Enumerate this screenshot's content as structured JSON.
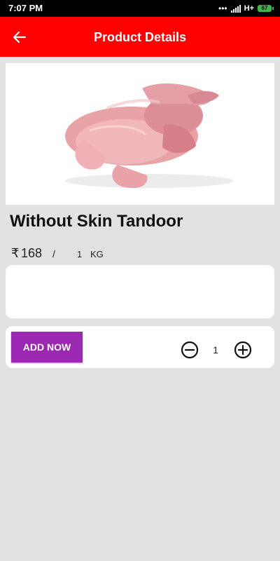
{
  "status_bar": {
    "time": "7:07 PM",
    "network": "H+",
    "battery": "67"
  },
  "app_bar": {
    "title": "Product Details",
    "back_icon": "back-arrow-icon"
  },
  "product": {
    "image_icon": "raw-chicken-image",
    "name": "Without Skin Tandoor",
    "currency_symbol": "₹",
    "price": "168",
    "separator": "/",
    "quantity": "1",
    "unit": "KG"
  },
  "actions": {
    "add_label": "ADD NOW",
    "quantity_value": "1",
    "minus_icon": "minus-circle-icon",
    "plus_icon": "plus-circle-icon"
  },
  "colors": {
    "app_bar": "#ff0000",
    "add_button": "#9c27b0",
    "background": "#e2e2e2"
  }
}
